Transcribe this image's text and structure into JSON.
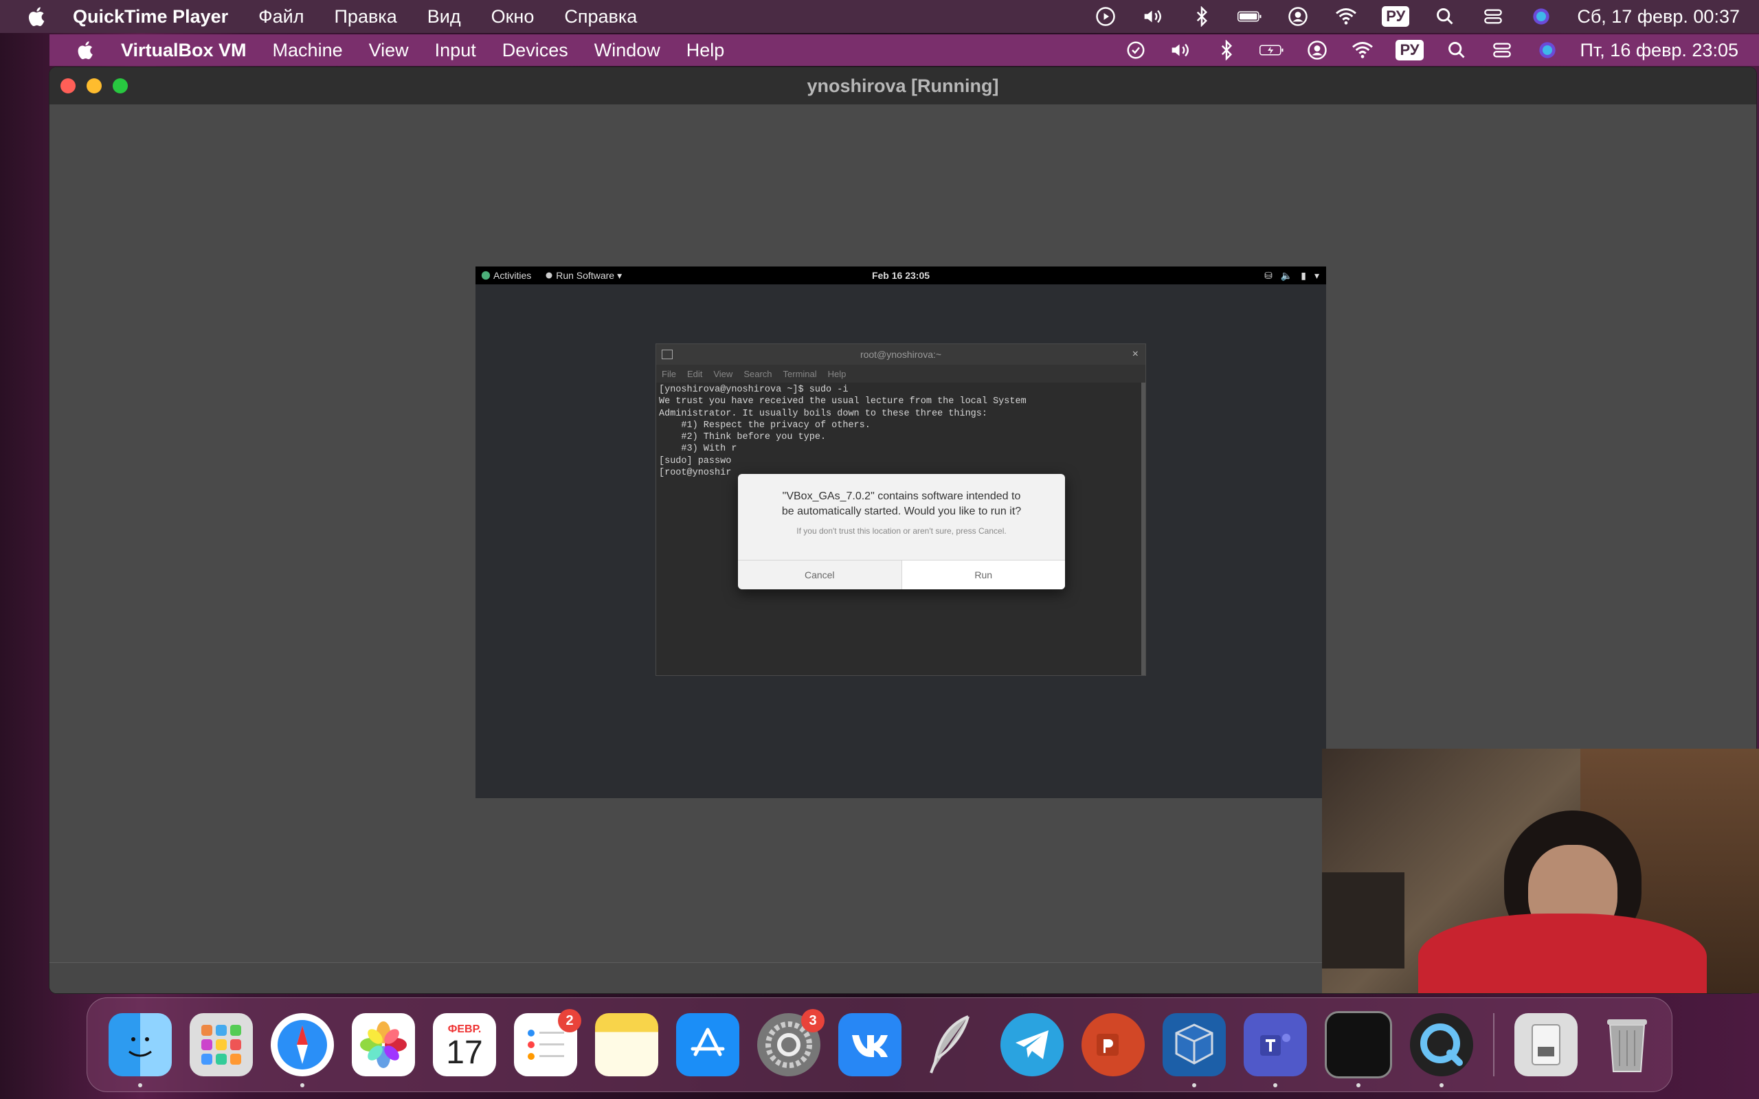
{
  "host_menubar": {
    "app_name": "QuickTime Player",
    "menus": [
      "Файл",
      "Правка",
      "Вид",
      "Окно",
      "Справка"
    ],
    "keyboard_layout": "РУ",
    "clock": "Сб, 17 февр.  00:37"
  },
  "vbox_menubar": {
    "app_name": "VirtualBox VM",
    "menus": [
      "Machine",
      "View",
      "Input",
      "Devices",
      "Window",
      "Help"
    ],
    "keyboard_layout": "РУ",
    "clock": "Пт, 16 февр.  23:05"
  },
  "vbox_window": {
    "title": "ynoshirova [Running]"
  },
  "guest": {
    "topbar": {
      "activities": "Activities",
      "app_menu": "Run Software",
      "clock": "Feb 16  23:05"
    },
    "terminal": {
      "title": "root@ynoshirova:~",
      "menus": [
        "File",
        "Edit",
        "View",
        "Search",
        "Terminal",
        "Help"
      ],
      "lines": [
        "[ynoshirova@ynoshirova ~]$ sudo -i",
        "",
        "We trust you have received the usual lecture from the local System",
        "Administrator. It usually boils down to these three things:",
        "",
        "    #1) Respect the privacy of others.",
        "    #2) Think before you type.",
        "    #3) With r",
        "",
        "[sudo] passwo",
        "[root@ynoshir"
      ]
    },
    "dialog": {
      "message_line1": "\"VBox_GAs_7.0.2\" contains software intended to",
      "message_line2": "be automatically started. Would you like to run it?",
      "sub": "If you don't trust this location or aren't sure, press Cancel.",
      "cancel_label": "Cancel",
      "run_label": "Run"
    }
  },
  "dock": {
    "calendar_month": "ФЕВР.",
    "calendar_day": "17",
    "reminders_badge": "2",
    "settings_badge": "3"
  }
}
